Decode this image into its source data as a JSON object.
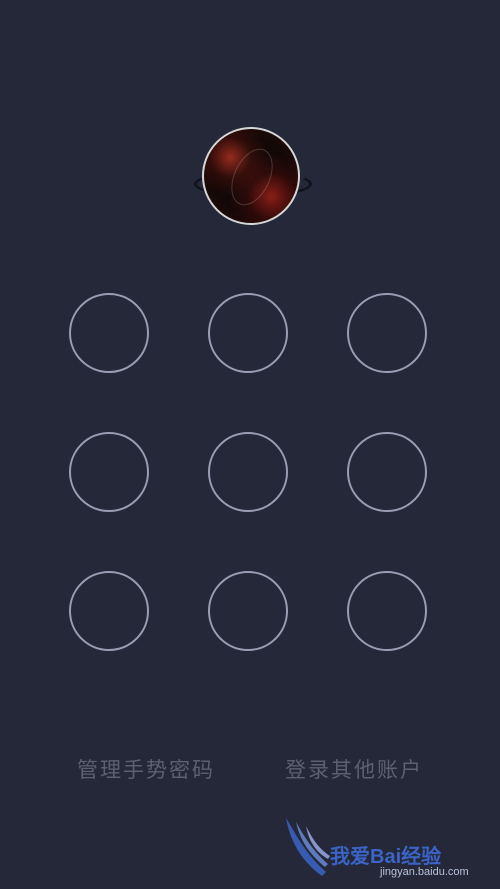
{
  "lock_screen": {
    "avatar": {
      "icon": "avatar-image"
    },
    "pattern_dots": [
      {
        "row": 1,
        "col": 1
      },
      {
        "row": 1,
        "col": 2
      },
      {
        "row": 1,
        "col": 3
      },
      {
        "row": 2,
        "col": 1
      },
      {
        "row": 2,
        "col": 2
      },
      {
        "row": 2,
        "col": 3
      },
      {
        "row": 3,
        "col": 1
      },
      {
        "row": 3,
        "col": 2
      },
      {
        "row": 3,
        "col": 3
      }
    ],
    "manage_gesture_label": "管理手势密码",
    "other_account_label": "登录其他账户"
  },
  "watermark": {
    "text": "我爱Bai经验",
    "url": "jingyan.baidu.com"
  },
  "colors": {
    "background": "#242838",
    "dot_ring": "#9c9cb4",
    "link_text": "#5c6070",
    "watermark_blue": "#3b64c6"
  }
}
